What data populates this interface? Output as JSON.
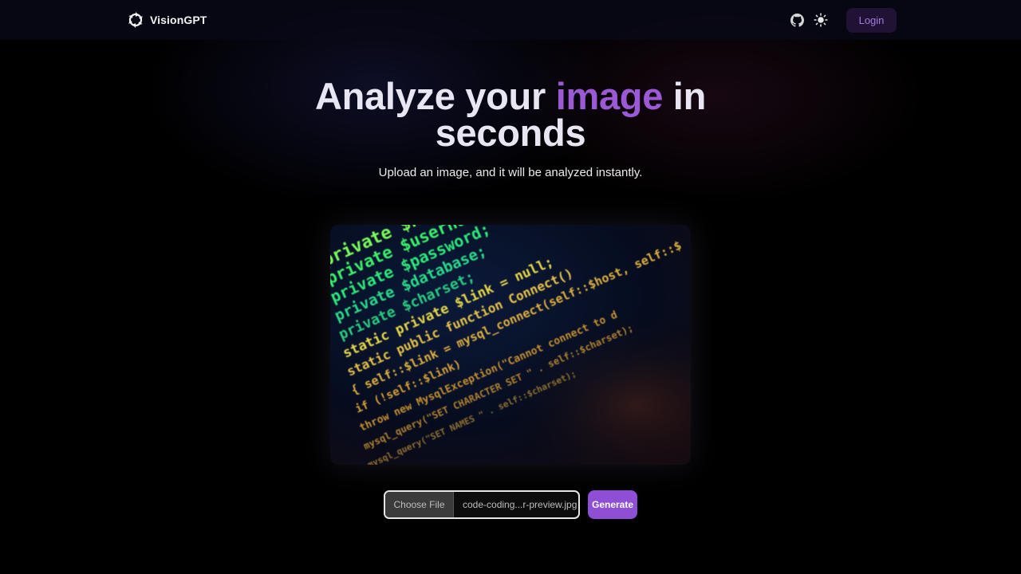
{
  "brand": {
    "name": "VisionGPT",
    "logo_icon": "aperture-logo-icon"
  },
  "nav": {
    "github_icon": "github-icon",
    "theme_icon": "sun-icon",
    "login_label": "Login"
  },
  "hero": {
    "title_part1": "Analyze your ",
    "title_accent": "image",
    "title_part2": " in",
    "title_line2": "seconds",
    "subtitle": "Upload an image, and it will be analyzed instantly."
  },
  "preview": {
    "code_lines": [
      {
        "text": "private $host;",
        "color": "#7CFC5A"
      },
      {
        "text": "private $username;",
        "color": "#3DF06A"
      },
      {
        "text": "private $password;",
        "color": "#2EE87A"
      },
      {
        "text": "private $database;",
        "color": "#2BD98A"
      },
      {
        "text": "private $charset;",
        "color": "#2ACB80"
      },
      {
        "text": "static private $link = null;",
        "color": "#E8D84A"
      },
      {
        "text": "static public function Connect()",
        "color": "#E8C24A"
      },
      {
        "text": "{ self::$link = mysql_connect(self::$host, self::$",
        "color": "#E0B040"
      },
      {
        "text": "if (!self::$link)",
        "color": "#D8A038"
      },
      {
        "text": "throw new MysqlException(\"Cannot connect to d",
        "color": "#C89030"
      },
      {
        "text": "mysql_query(\"SET CHARACTER SET \" . self::$charset);",
        "color": "#B08030"
      },
      {
        "text": "mysql_query(\"SET NAMES \" . self::$charset);",
        "color": "#907030"
      },
      {
        "text": "}",
        "color": "#806030"
      }
    ]
  },
  "upload": {
    "choose_label": "Choose File",
    "file_name": "code-coding...r-preview.jpg",
    "generate_label": "Generate"
  },
  "colors": {
    "accent": "#9b59d6",
    "button": "#8e4fd6",
    "login_bg": "#1f1234"
  }
}
